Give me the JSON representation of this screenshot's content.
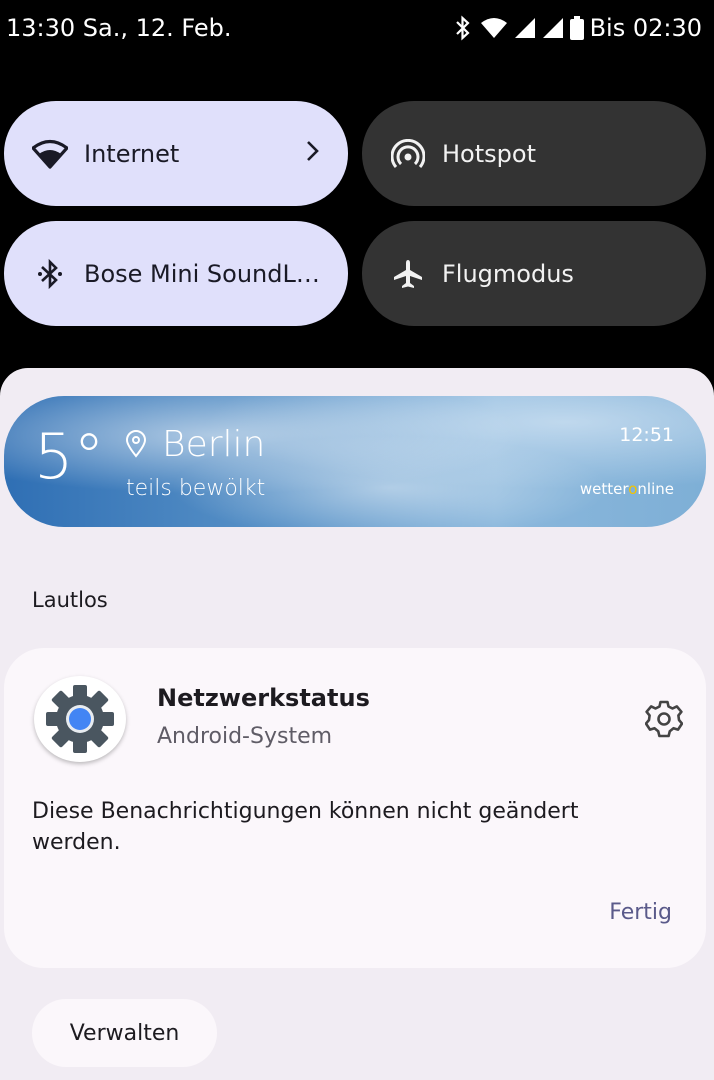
{
  "status_bar": {
    "time_date": "13:30 Sa., 12. Feb.",
    "battery_text": "Bis 02:30",
    "icons": [
      "bluetooth-icon",
      "wifi-icon",
      "signal-icon",
      "signal-icon",
      "battery-icon"
    ]
  },
  "quick_tiles": [
    {
      "label": "Internet",
      "state": "on",
      "icon": "wifi-icon",
      "has_chevron": true
    },
    {
      "label": "Hotspot",
      "state": "off",
      "icon": "hotspot-icon"
    },
    {
      "label": "Bose Mini SoundL…",
      "state": "on",
      "icon": "bluetooth-icon"
    },
    {
      "label": "Flugmodus",
      "state": "off",
      "icon": "airplane-icon"
    }
  ],
  "weather": {
    "temperature": "5°",
    "city": "Berlin",
    "description": "teils bewölkt",
    "time": "12:51",
    "brand_prefix": "wetter",
    "brand_o": "o",
    "brand_suffix": "nline"
  },
  "section_label": "Lautlos",
  "notification": {
    "title": "Netzwerkstatus",
    "app_name": "Android-System",
    "body": "Diese Benachrichtigungen können nicht geändert werden.",
    "action": "Fertig"
  },
  "manage_button": "Verwalten",
  "colors": {
    "tile_on": "#e0e0fb",
    "tile_off": "#333333",
    "shade": "#f1ecf3",
    "accent_blue": "#4285f4"
  }
}
